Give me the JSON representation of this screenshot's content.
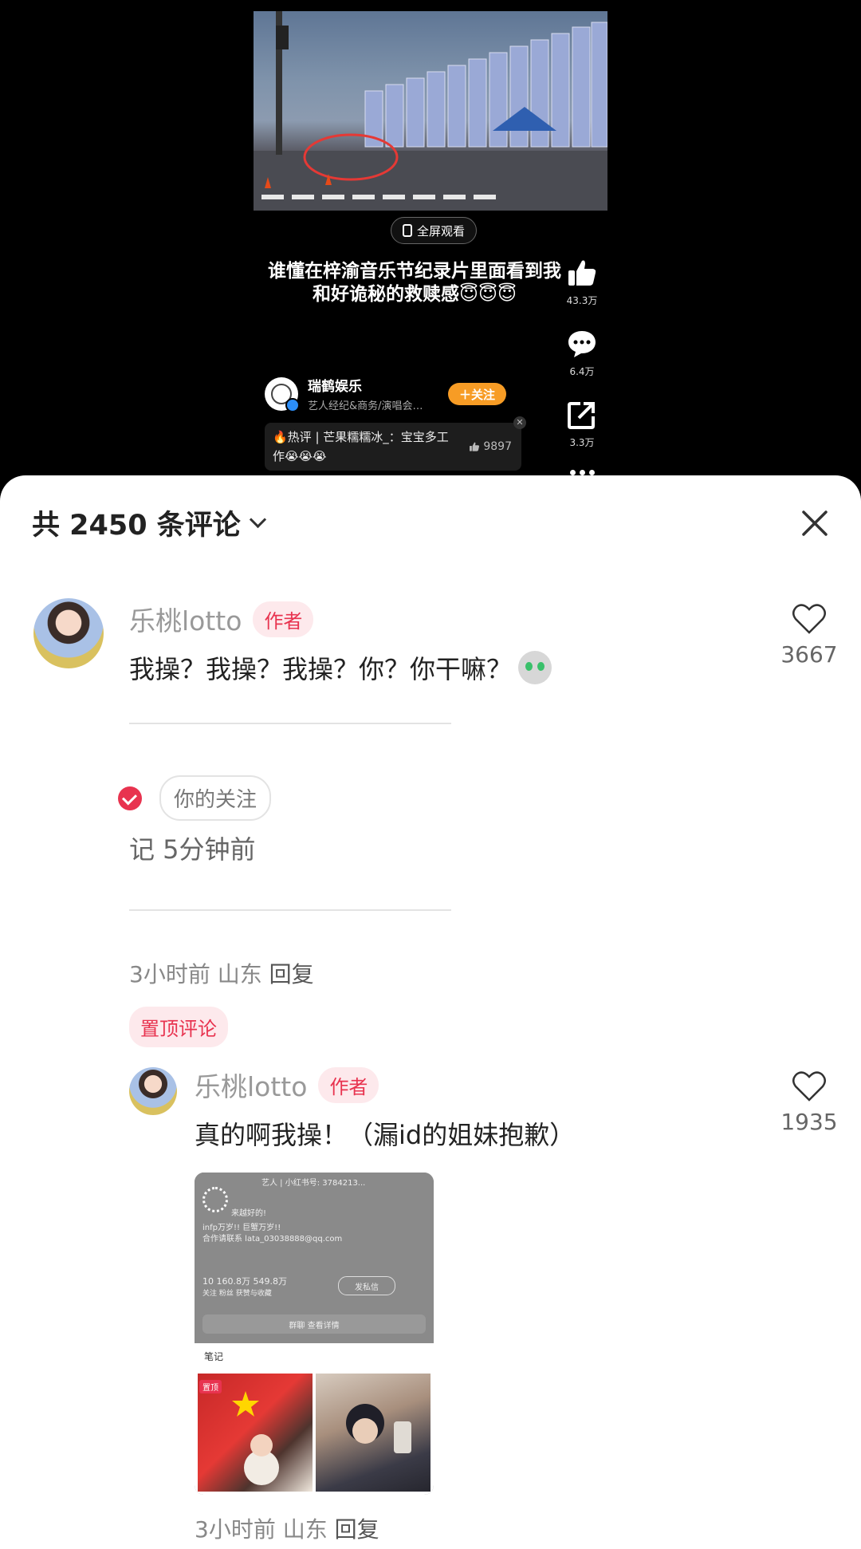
{
  "video": {
    "fullscreen_label": "全屏观看",
    "caption": "谁懂在梓渝音乐节纪录片里面看到我和好诡秘的救赎感😇😇😇",
    "likes": "43.3万",
    "comments": "6.4万",
    "shares": "3.3万",
    "author_name": "瑞鹤娱乐",
    "author_desc": "艺人经纪&商务/演唱会…",
    "follow_label": "＋关注",
    "hot_comment": "🔥热评 | 芒果糯糯冰_：宝宝多工作😭😭😭",
    "hot_comment_likes": "9897"
  },
  "sheet": {
    "title": "共 2450 条评论"
  },
  "comment1": {
    "name": "乐桃lotto",
    "badge": "作者",
    "text": "我操？我操？我操？你？你干嘛？",
    "likes": "3667"
  },
  "note_preview": {
    "follow_pill": "你的关注",
    "time_text": "记  5分钟前"
  },
  "meta1": {
    "time": "3小时前",
    "location": "山东",
    "reply": "回复"
  },
  "pinned_label": "置顶评论",
  "comment2": {
    "name": "乐桃lotto",
    "badge": "作者",
    "text": "真的啊我操！（漏id的姐妹抱歉）",
    "likes": "1935"
  },
  "attachment": {
    "line1": "艺人 | 小红书号: 3784213...",
    "line2": "来越好的!",
    "line3": "infp万岁!! 巨蟹万岁!!",
    "line4": "合作请联系 lata_03038888@qq.com",
    "fans_stat": "10   160.8万   549.8万",
    "fans_labels": "关注     粉丝     获赞与收藏",
    "message_btn": "发私信",
    "group_bar": "群聊  查看详情",
    "notes_label": "笔记",
    "pin_tag": "置顶"
  },
  "meta2": {
    "time": "3小时前",
    "location": "山东",
    "reply": "回复"
  },
  "colors": {
    "accent": "#e8334f",
    "follow_orange": "#f79c25"
  }
}
